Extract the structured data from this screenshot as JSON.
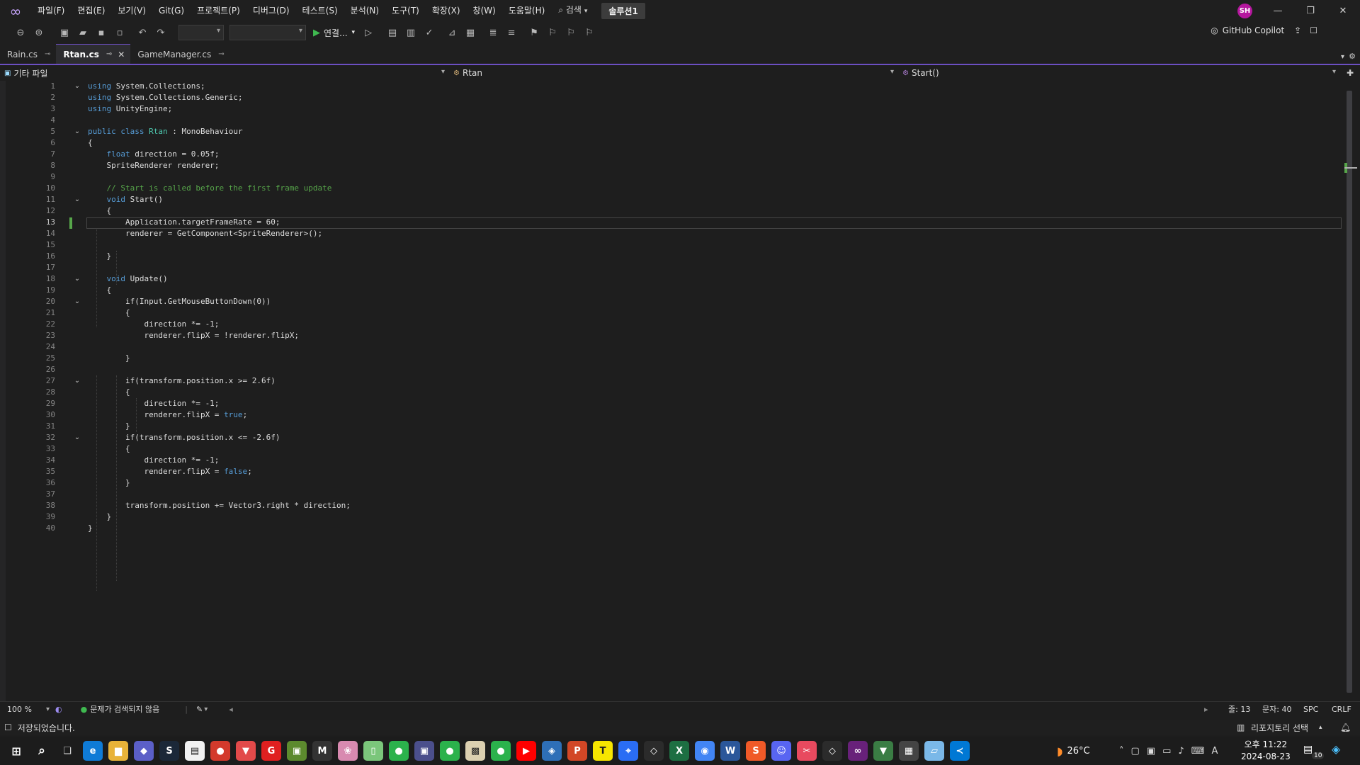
{
  "menu": {
    "items": [
      "파일(F)",
      "편집(E)",
      "보기(V)",
      "Git(G)",
      "프로젝트(P)",
      "디버그(D)",
      "테스트(S)",
      "분석(N)",
      "도구(T)",
      "확장(X)",
      "창(W)",
      "도움말(H)"
    ],
    "search_label": "검색",
    "solution_name": "솔루션1"
  },
  "user": {
    "initials": "SH",
    "avatar_color": "#b5179e"
  },
  "toolbar": {
    "run_label": "연결...",
    "copilot_label": "GitHub Copilot"
  },
  "tabs": [
    {
      "label": "Rain.cs",
      "active": false,
      "closable": false
    },
    {
      "label": "Rtan.cs",
      "active": true,
      "closable": true
    },
    {
      "label": "GameManager.cs",
      "active": false,
      "closable": false
    }
  ],
  "navbar": {
    "project": "기타 파일",
    "type": "Rtan",
    "member": "Start()"
  },
  "editor": {
    "current_line": 13,
    "lines": [
      [
        [
          "kw",
          "using"
        ],
        [
          "t",
          " System.Collections;"
        ]
      ],
      [
        [
          "kw",
          "using"
        ],
        [
          "t",
          " System.Collections.Generic;"
        ]
      ],
      [
        [
          "kw",
          "using"
        ],
        [
          "t",
          " UnityEngine;"
        ]
      ],
      [],
      [
        [
          "kw",
          "public"
        ],
        [
          "t",
          " "
        ],
        [
          "kw",
          "class"
        ],
        [
          "t",
          " "
        ],
        [
          "ty",
          "Rtan"
        ],
        [
          "t",
          " : MonoBehaviour"
        ]
      ],
      [
        [
          "t",
          "{"
        ]
      ],
      [
        [
          "t",
          "    "
        ],
        [
          "kw",
          "float"
        ],
        [
          "t",
          " direction = 0.05f;"
        ]
      ],
      [
        [
          "t",
          "    SpriteRenderer renderer;"
        ]
      ],
      [],
      [
        [
          "t",
          "    "
        ],
        [
          "cm",
          "// Start is called before the first frame update"
        ]
      ],
      [
        [
          "t",
          "    "
        ],
        [
          "kw",
          "void"
        ],
        [
          "t",
          " Start()"
        ]
      ],
      [
        [
          "t",
          "    {"
        ]
      ],
      [
        [
          "t",
          "        Application.targetFrameRate = 60;"
        ]
      ],
      [
        [
          "t",
          "        renderer = GetComponent<SpriteRenderer>();"
        ]
      ],
      [],
      [
        [
          "t",
          "    }"
        ]
      ],
      [],
      [
        [
          "t",
          "    "
        ],
        [
          "kw",
          "void"
        ],
        [
          "t",
          " Update()"
        ]
      ],
      [
        [
          "t",
          "    {"
        ]
      ],
      [
        [
          "t",
          "        if(Input.GetMouseButtonDown(0))"
        ]
      ],
      [
        [
          "t",
          "        {"
        ]
      ],
      [
        [
          "t",
          "            direction *= -1;"
        ]
      ],
      [
        [
          "t",
          "            renderer.flipX = !renderer.flipX;"
        ]
      ],
      [],
      [
        [
          "t",
          "        }"
        ]
      ],
      [],
      [
        [
          "t",
          "        if(transform.position.x >= 2.6f)"
        ]
      ],
      [
        [
          "t",
          "        {"
        ]
      ],
      [
        [
          "t",
          "            direction *= -1;"
        ]
      ],
      [
        [
          "t",
          "            renderer.flipX = "
        ],
        [
          "kw",
          "true"
        ],
        [
          "t",
          ";"
        ]
      ],
      [
        [
          "t",
          "        }"
        ]
      ],
      [
        [
          "t",
          "        if(transform.position.x <= -2.6f)"
        ]
      ],
      [
        [
          "t",
          "        {"
        ]
      ],
      [
        [
          "t",
          "            direction *= -1;"
        ]
      ],
      [
        [
          "t",
          "            renderer.flipX = "
        ],
        [
          "kw",
          "false"
        ],
        [
          "t",
          ";"
        ]
      ],
      [
        [
          "t",
          "        }"
        ]
      ],
      [],
      [
        [
          "t",
          "        transform.position += Vector3.right * direction;"
        ]
      ],
      [
        [
          "t",
          "    }"
        ]
      ],
      [
        [
          "t",
          "}"
        ]
      ]
    ],
    "fold_lines": [
      1,
      5,
      11,
      18,
      20,
      27,
      32
    ]
  },
  "editor_status": {
    "zoom": "100 %",
    "issues": "문제가 검색되지 않음",
    "line": "줄: 13",
    "char": "문자: 40",
    "whitespace": "SPC",
    "line_ending": "CRLF"
  },
  "statusbar": {
    "message": "저장되었습니다.",
    "repo": "리포지토리 선택"
  },
  "taskbar": {
    "weather": "26°C",
    "time": "오후 11:22",
    "date": "2024-08-23",
    "ime": "A",
    "notifications": "10",
    "apps": [
      {
        "name": "edge-icon",
        "color": "#0f7bd6",
        "glyph": "e"
      },
      {
        "name": "file-explorer-icon",
        "color": "#e8b339",
        "glyph": "▆"
      },
      {
        "name": "copilot-app-icon",
        "color": "#5b5fc7",
        "glyph": "◆"
      },
      {
        "name": "steam-icon",
        "color": "#1b2838",
        "glyph": "S"
      },
      {
        "name": "notes-icon",
        "color": "#f2f2f2",
        "glyph": "▤"
      },
      {
        "name": "game-icon",
        "color": "#d33a2c",
        "glyph": "●"
      },
      {
        "name": "game2-icon",
        "color": "#e24a4a",
        "glyph": "▼"
      },
      {
        "name": "gloss-icon",
        "color": "#e02020",
        "glyph": "G"
      },
      {
        "name": "minecraft-icon",
        "color": "#5c8a2e",
        "glyph": "▣"
      },
      {
        "name": "m-app-icon",
        "color": "#333333",
        "glyph": "M"
      },
      {
        "name": "photo-app-icon",
        "color": "#d88ab0",
        "glyph": "❀"
      },
      {
        "name": "notepad-icon",
        "color": "#7bc67b",
        "glyph": "▯"
      },
      {
        "name": "line-icon",
        "color": "#2bb24c",
        "glyph": "●"
      },
      {
        "name": "terminal-icon",
        "color": "#4b4f8c",
        "glyph": "▣"
      },
      {
        "name": "line2-icon",
        "color": "#2bb24c",
        "glyph": "●"
      },
      {
        "name": "photo2-icon",
        "color": "#dcd0b0",
        "glyph": "▩"
      },
      {
        "name": "line3-icon",
        "color": "#2bb24c",
        "glyph": "●"
      },
      {
        "name": "youtube-icon",
        "color": "#ff0000",
        "glyph": "▶"
      },
      {
        "name": "unity-hub-icon",
        "color": "#2e6fb7",
        "glyph": "◈"
      },
      {
        "name": "powerpoint-icon",
        "color": "#d24726",
        "glyph": "P"
      },
      {
        "name": "kakaotalk-icon",
        "color": "#f7e600",
        "glyph": "T"
      },
      {
        "name": "maps-icon",
        "color": "#2a6df4",
        "glyph": "⌖"
      },
      {
        "name": "unity-icon",
        "color": "#2b2b2b",
        "glyph": "◇"
      },
      {
        "name": "excel-icon",
        "color": "#1d6f42",
        "glyph": "X"
      },
      {
        "name": "chrome-icon",
        "color": "#4285f4",
        "glyph": "◉"
      },
      {
        "name": "word-icon",
        "color": "#2b579a",
        "glyph": "W"
      },
      {
        "name": "s-app-icon",
        "color": "#f05a28",
        "glyph": "S"
      },
      {
        "name": "discord-icon",
        "color": "#5865f2",
        "glyph": "☺"
      },
      {
        "name": "snip-icon",
        "color": "#e84a5f",
        "glyph": "✂"
      },
      {
        "name": "unity2-icon",
        "color": "#2b2b2b",
        "glyph": "◇"
      },
      {
        "name": "visual-studio-icon",
        "color": "#68217a",
        "glyph": "∞"
      },
      {
        "name": "shield-app-icon",
        "color": "#3a7d44",
        "glyph": "▼"
      },
      {
        "name": "calculator-icon",
        "color": "#444444",
        "glyph": "▦"
      },
      {
        "name": "paint-icon",
        "color": "#7ab8e8",
        "glyph": "▱"
      },
      {
        "name": "vscode-icon",
        "color": "#0078d4",
        "glyph": "≺"
      }
    ]
  }
}
